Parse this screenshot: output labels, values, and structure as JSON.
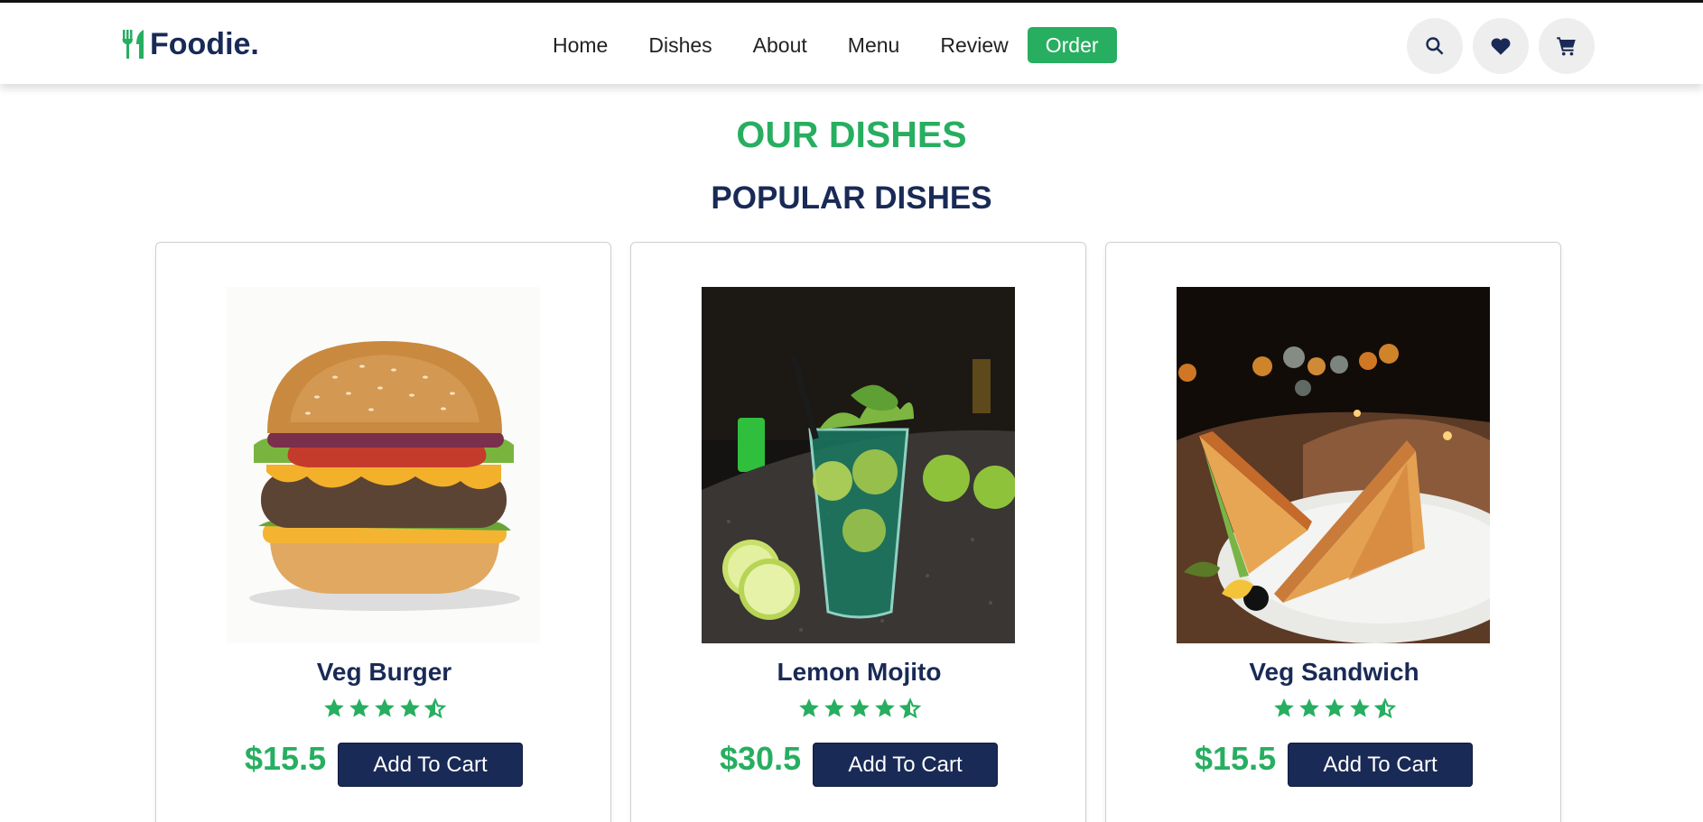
{
  "header": {
    "logo_text": "Foodie.",
    "logo_icon": "utensils-icon",
    "nav": [
      "Home",
      "Dishes",
      "About",
      "Menu",
      "Review",
      "Order"
    ],
    "active_nav": "Order",
    "icons": [
      "search-icon",
      "heart-icon",
      "cart-icon"
    ]
  },
  "section": {
    "sub_heading": "OUR DISHES",
    "heading": "POPULAR DISHES"
  },
  "dishes": [
    {
      "name": "Veg Burger",
      "rating": 4.5,
      "price": "$15.5",
      "button": "Add To Cart",
      "image": "burger-image"
    },
    {
      "name": "Lemon Mojito",
      "rating": 4.5,
      "price": "$30.5",
      "button": "Add To Cart",
      "image": "mojito-image"
    },
    {
      "name": "Veg Sandwich",
      "rating": 4.5,
      "price": "$15.5",
      "button": "Add To Cart",
      "image": "sandwich-image"
    }
  ],
  "colors": {
    "accent": "#27ae60",
    "primary": "#192a56",
    "icon_bg": "#eeeeee"
  }
}
